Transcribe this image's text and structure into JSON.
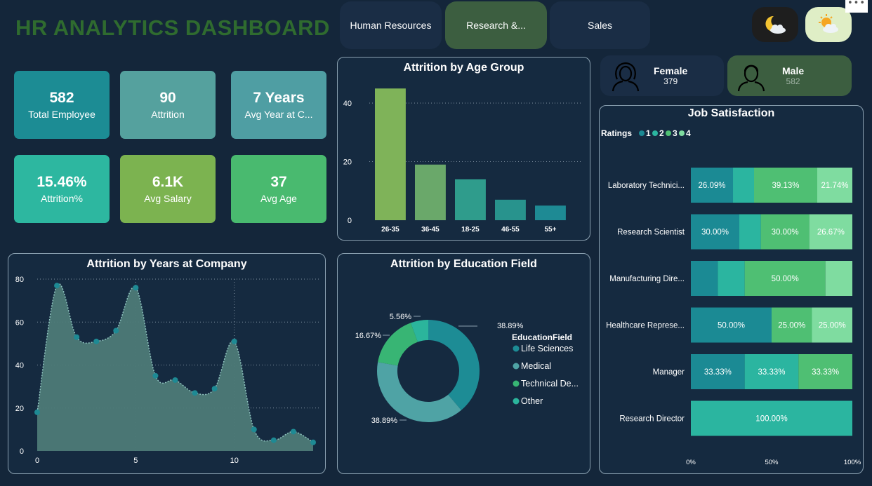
{
  "title": "HR ANALYTICS DASHBOARD",
  "tabs": [
    {
      "label": "Human Resources"
    },
    {
      "label": "Research &..."
    },
    {
      "label": "Sales"
    }
  ],
  "icons": {
    "dark_mode": "moon-cloud-icon",
    "light_mode": "sun-cloud-icon",
    "more": "more-options-icon"
  },
  "kpis": [
    {
      "value": "582",
      "label": "Total Employee",
      "color": "#1c8c94"
    },
    {
      "value": "90",
      "label": "Attrition",
      "color": "#55a19e"
    },
    {
      "value": "7 Years",
      "label": "Avg Year at C...",
      "color": "#4f9ea3"
    },
    {
      "value": "15.46%",
      "label": "Attrition%",
      "color": "#2db7a0"
    },
    {
      "value": "6.1K",
      "label": "Avg Salary",
      "color": "#7cb350"
    },
    {
      "value": "37",
      "label": "Avg Age",
      "color": "#49ba6f"
    }
  ],
  "gender": {
    "female": {
      "label": "Female",
      "count": "379"
    },
    "male": {
      "label": "Male",
      "count": "582"
    }
  },
  "colors": {
    "c1": "#1b8a94",
    "c2": "#2bb5a0",
    "c3": "#4fbf73",
    "c4": "#7fdca0",
    "accent_title": "#2f6b2f"
  },
  "chart_data": [
    {
      "id": "age",
      "type": "bar",
      "title": "Attrition by Age Group",
      "categories": [
        "26-35",
        "36-45",
        "18-25",
        "46-55",
        "55+"
      ],
      "values": [
        45,
        19,
        14,
        7,
        5
      ],
      "colors": [
        "#7fb359",
        "#6aa86a",
        "#2f9c8c",
        "#28938d",
        "#1e8a94"
      ],
      "yticks": [
        0,
        20,
        40
      ],
      "ylim": [
        0,
        46
      ]
    },
    {
      "id": "years",
      "type": "area",
      "title": "Attrition by Years at Company",
      "x": [
        0,
        1,
        2,
        3,
        4,
        5,
        6,
        7,
        8,
        9,
        10,
        11,
        12,
        13,
        14
      ],
      "values": [
        18,
        77,
        53,
        51,
        56,
        76,
        35,
        33,
        27,
        29,
        51,
        10,
        5,
        9,
        4
      ],
      "xticks": [
        0,
        5,
        10
      ],
      "yticks": [
        0,
        20,
        40,
        60,
        80
      ],
      "ylim": [
        0,
        80
      ]
    },
    {
      "id": "education",
      "type": "pie",
      "title": "Attrition by Education Field",
      "legend_title": "EducationField",
      "labels": [
        "Life Sciences",
        "Medical",
        "Technical De...",
        "Other"
      ],
      "values": [
        38.89,
        38.89,
        16.67,
        5.56
      ],
      "value_labels": [
        "38.89%",
        "38.89%",
        "16.67%",
        "5.56%"
      ],
      "colors": [
        "#1d8c95",
        "#4fa3a5",
        "#38b574",
        "#2bb59c"
      ]
    },
    {
      "id": "satisfaction",
      "type": "bar",
      "orientation": "horizontal-stacked-100",
      "title": "Job Satisfaction",
      "legend_title": "Ratings",
      "series_names": [
        "1",
        "2",
        "3",
        "4"
      ],
      "categories": [
        "Laboratory Technici...",
        "Research Scientist",
        "Manufacturing Dire...",
        "Healthcare Represe...",
        "Manager",
        "Research Director"
      ],
      "values": [
        [
          26.09,
          13.04,
          39.13,
          21.74
        ],
        [
          30.0,
          13.33,
          30.0,
          26.67
        ],
        [
          16.67,
          16.67,
          50.0,
          16.67
        ],
        [
          50.0,
          0,
          25.0,
          25.0
        ],
        [
          33.33,
          33.33,
          33.33,
          0
        ],
        [
          0,
          100.0,
          0,
          0
        ]
      ],
      "labels": [
        [
          "26.09%",
          "",
          "39.13%",
          "21.74%"
        ],
        [
          "30.00%",
          "",
          "30.00%",
          "26.67%"
        ],
        [
          "",
          "",
          "50.00%",
          ""
        ],
        [
          "50.00%",
          "",
          "25.00%",
          "25.00%"
        ],
        [
          "33.33%",
          "33.33%",
          "33.33%",
          ""
        ],
        [
          "",
          "100.00%",
          "",
          ""
        ]
      ],
      "xticks": [
        "0%",
        "50%",
        "100%"
      ]
    }
  ]
}
